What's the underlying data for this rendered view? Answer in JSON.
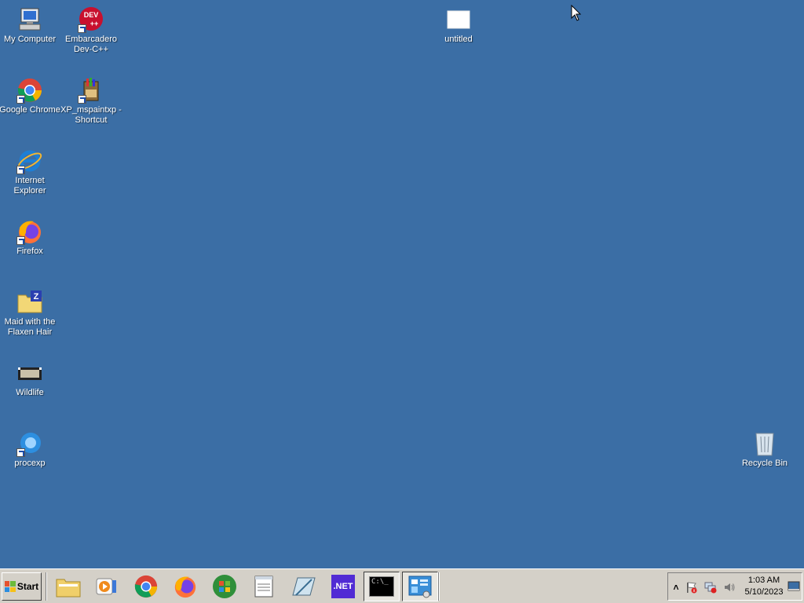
{
  "desktop": {
    "background": "#3b6ea5",
    "icons": [
      {
        "label": "My Computer",
        "icon": "computer-icon"
      },
      {
        "label": "Embarcadero Dev-C++",
        "icon": "devcpp-icon"
      },
      {
        "label": "untitled",
        "icon": "blank-file-icon"
      },
      {
        "label": "Google Chrome",
        "icon": "chrome-icon"
      },
      {
        "label": "XP_mspaintxp - Shortcut",
        "icon": "paint-icon"
      },
      {
        "label": "Internet Explorer",
        "icon": "ie-icon"
      },
      {
        "label": "Firefox",
        "icon": "firefox-icon"
      },
      {
        "label": "Maid with the Flaxen Hair",
        "icon": "zip-folder-icon"
      },
      {
        "label": "Wildlife",
        "icon": "video-icon"
      },
      {
        "label": "procexp",
        "icon": "procexp-icon"
      },
      {
        "label": "Recycle Bin",
        "icon": "recycle-bin-icon"
      }
    ]
  },
  "taskbar": {
    "start_label": "Start",
    "apps": [
      {
        "name": "File Explorer",
        "icon": "folder-icon"
      },
      {
        "name": "Media Player",
        "icon": "media-player-icon"
      },
      {
        "name": "Google Chrome",
        "icon": "chrome-icon"
      },
      {
        "name": "Firefox",
        "icon": "firefox-icon"
      },
      {
        "name": "Windows",
        "icon": "windows-logo-icon"
      },
      {
        "name": "Notepad",
        "icon": "notepad-icon"
      },
      {
        "name": "Editor",
        "icon": "pencil-pad-icon"
      },
      {
        "name": ".NET",
        "icon": "dotnet-icon",
        "text": ".NET"
      },
      {
        "name": "Command Prompt",
        "icon": "cmd-icon",
        "text": "C:\\_"
      },
      {
        "name": "Control Panel",
        "icon": "control-panel-icon"
      }
    ],
    "tray": {
      "time": "1:03 AM",
      "date": "5/10/2023"
    }
  }
}
